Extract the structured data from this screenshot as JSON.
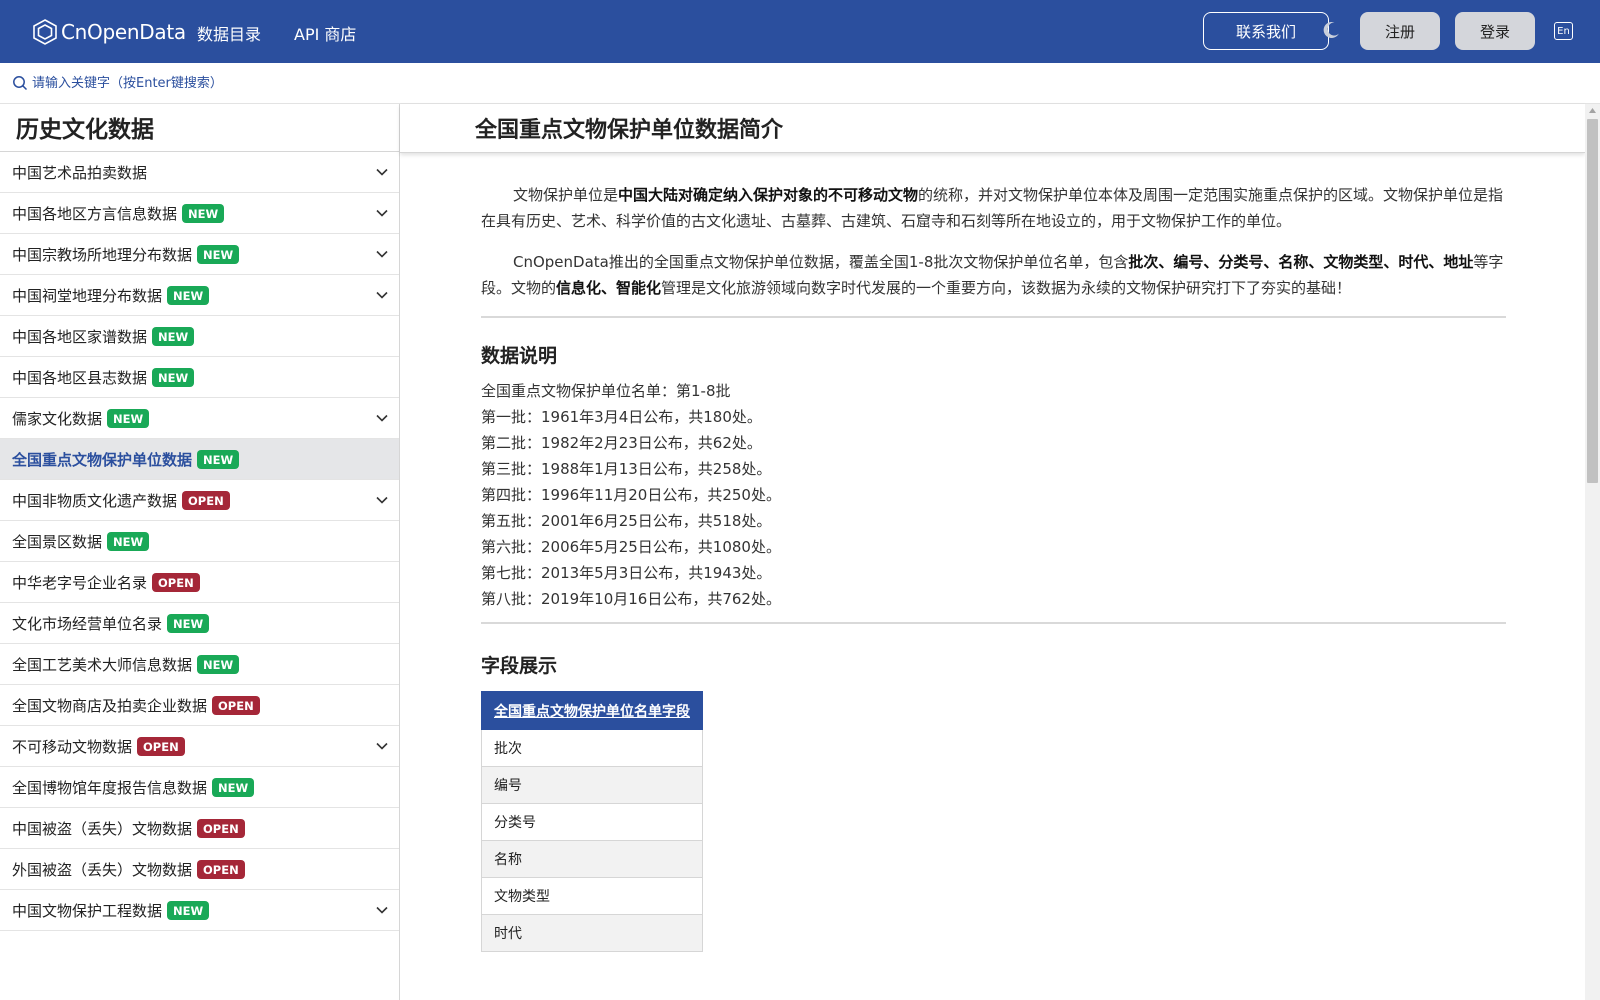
{
  "navbar": {
    "brand": "CnOpenData",
    "links": [
      "数据目录",
      "API 商店"
    ],
    "contact_label": "联系我们",
    "theme_icon": "moon-icon",
    "register_label": "注册",
    "login_label": "登录",
    "language_label": "En",
    "background_color": "#2b4f9e"
  },
  "search": {
    "placeholder": "请输入关键字（按Enter键搜索）"
  },
  "sidebar": {
    "title": "历史文化数据",
    "items": [
      {
        "label": "中国艺术品拍卖数据",
        "badge": "",
        "expandable": true,
        "active": false
      },
      {
        "label": "中国各地区方言信息数据",
        "badge": "NEW",
        "expandable": true,
        "active": false
      },
      {
        "label": "中国宗教场所地理分布数据",
        "badge": "NEW",
        "expandable": true,
        "active": false
      },
      {
        "label": "中国祠堂地理分布数据",
        "badge": "NEW",
        "expandable": true,
        "active": false
      },
      {
        "label": "中国各地区家谱数据",
        "badge": "NEW",
        "expandable": false,
        "active": false
      },
      {
        "label": "中国各地区县志数据",
        "badge": "NEW",
        "expandable": false,
        "active": false
      },
      {
        "label": "儒家文化数据",
        "badge": "NEW",
        "expandable": true,
        "active": false
      },
      {
        "label": "全国重点文物保护单位数据",
        "badge": "NEW",
        "expandable": false,
        "active": true
      },
      {
        "label": "中国非物质文化遗产数据",
        "badge": "OPEN",
        "expandable": true,
        "active": false
      },
      {
        "label": "全国景区数据",
        "badge": "NEW",
        "expandable": false,
        "active": false
      },
      {
        "label": "中华老字号企业名录",
        "badge": "OPEN",
        "expandable": false,
        "active": false
      },
      {
        "label": "文化市场经营单位名录",
        "badge": "NEW",
        "expandable": false,
        "active": false
      },
      {
        "label": "全国工艺美术大师信息数据",
        "badge": "NEW",
        "expandable": false,
        "active": false
      },
      {
        "label": "全国文物商店及拍卖企业数据",
        "badge": "OPEN",
        "expandable": false,
        "active": false
      },
      {
        "label": "不可移动文物数据",
        "badge": "OPEN",
        "expandable": true,
        "active": false
      },
      {
        "label": "全国博物馆年度报告信息数据",
        "badge": "NEW",
        "expandable": false,
        "active": false
      },
      {
        "label": "中国被盗（丢失）文物数据",
        "badge": "OPEN",
        "expandable": false,
        "active": false
      },
      {
        "label": "外国被盗（丢失）文物数据",
        "badge": "OPEN",
        "expandable": false,
        "active": false
      },
      {
        "label": "中国文物保护工程数据",
        "badge": "NEW",
        "expandable": true,
        "active": false
      }
    ],
    "badge_colors": {
      "NEW": "#19a957",
      "OPEN": "#a52738"
    }
  },
  "main": {
    "title": "全国重点文物保护单位数据简介",
    "intro": {
      "p1": [
        {
          "text": "文物保护单位是",
          "bold": false
        },
        {
          "text": "中国大陆对确定纳入保护对象的不可移动文物",
          "bold": true
        },
        {
          "text": "的统称，并对文物保护单位本体及周围一定范围实施重点保护的区域。文物保护单位是指在具有历史、艺术、科学价值的古文化遗址、古墓葬、古建筑、石窟寺和石刻等所在地设立的，用于文物保护工作的单位。",
          "bold": false
        }
      ],
      "p2": [
        {
          "text": "CnOpenData推出的全国重点文物保护单位数据，覆盖全国1-8批次文物保护单位名单，包含",
          "bold": false
        },
        {
          "text": "批次、编号、分类号、名称、文物类型、时代、地址",
          "bold": true
        },
        {
          "text": "等字段。文物的",
          "bold": false
        },
        {
          "text": "信息化、智能化",
          "bold": true
        },
        {
          "text": "管理是文化旅游领域向数字时代发展的一个重要方向，该数据为永续的文物保护研究打下了夯实的基础！",
          "bold": false
        }
      ]
    },
    "data_desc": {
      "heading": "数据说明",
      "lines": [
        "全国重点文物保护单位名单：第1-8批",
        "第一批：1961年3月4日公布，共180处。",
        "第二批：1982年2月23日公布，共62处。",
        "第三批：1988年1月13日公布，共258处。",
        "第四批：1996年11月20日公布，共250处。",
        "第五批：2001年6月25日公布，共518处。",
        "第六批：2006年5月25日公布，共1080处。",
        "第七批：2013年5月3日公布，共1943处。",
        "第八批：2019年10月16日公布，共762处。"
      ]
    },
    "fields": {
      "heading": "字段展示",
      "table_header": "全国重点文物保护单位名单字段",
      "rows": [
        "批次",
        "编号",
        "分类号",
        "名称",
        "文物类型",
        "时代"
      ]
    }
  }
}
